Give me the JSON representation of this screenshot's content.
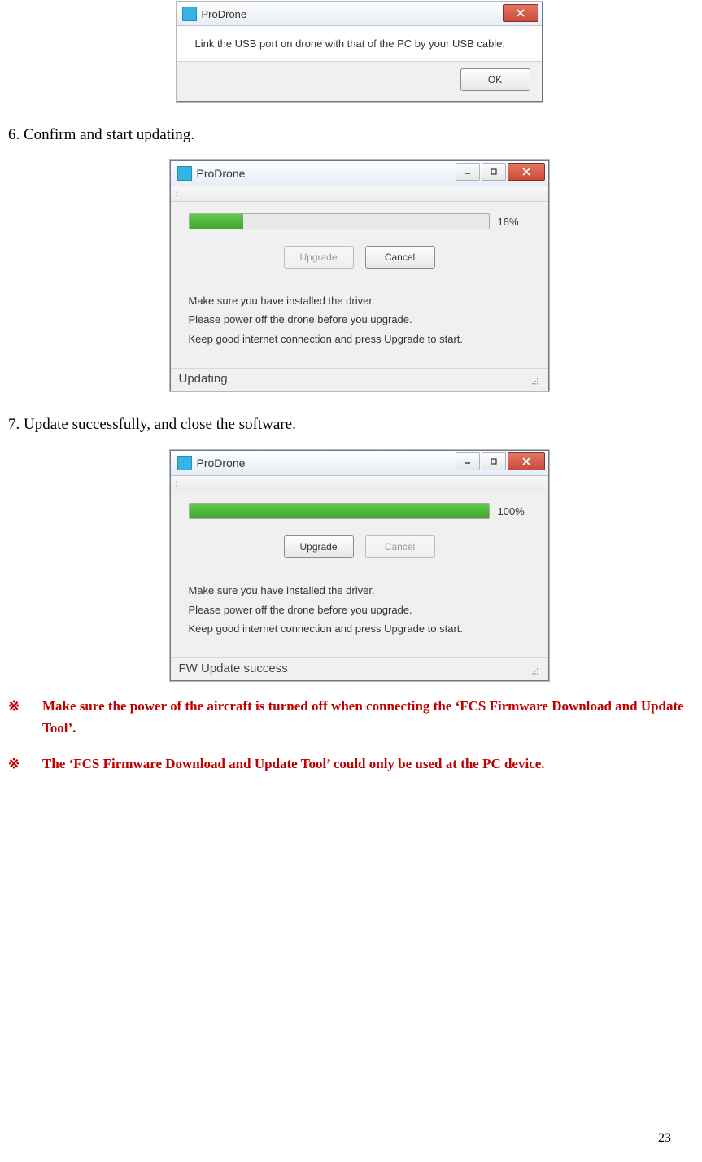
{
  "dialog1": {
    "title": "ProDrone",
    "message": "Link the USB port on drone with that of the PC by your USB cable.",
    "ok_label": "OK"
  },
  "step6": "6. Confirm and start updating.",
  "dialog2": {
    "title": "ProDrone",
    "percent": "18%",
    "percent_value": 18,
    "upgrade_label": "Upgrade",
    "cancel_label": "Cancel",
    "info1": "Make sure you have installed the driver.",
    "info2": "Please power off the drone before you upgrade.",
    "info3": "Keep good internet connection and press Upgrade to start.",
    "status": "Updating"
  },
  "step7": "7. Update successfully, and close the software.",
  "dialog3": {
    "title": "ProDrone",
    "percent": "100%",
    "percent_value": 100,
    "upgrade_label": "Upgrade",
    "cancel_label": "Cancel",
    "info1": "Make sure you have installed the driver.",
    "info2": "Please power off the drone before you upgrade.",
    "info3": "Keep good internet connection and press Upgrade to start.",
    "status": "FW Update success"
  },
  "notes": {
    "sym": "※",
    "n1": "Make sure the power of the aircraft is turned off when connecting the ‘FCS Firmware Download and Update Tool’.",
    "n2": "The ‘FCS Firmware Download and Update Tool’ could only be used at the PC device."
  },
  "page_number": "23"
}
